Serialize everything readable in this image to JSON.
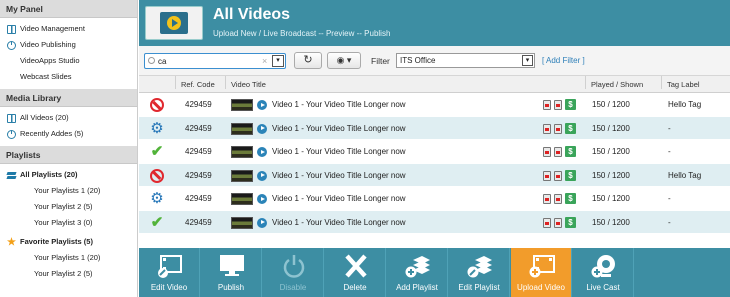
{
  "sidebar": {
    "my_panel": {
      "title": "My Panel",
      "items": [
        {
          "label": "Video Management",
          "icon": "film-icon"
        },
        {
          "label": "Video Publishing",
          "icon": "clock-icon"
        },
        {
          "label": "VideoApps Studio",
          "icon": ""
        },
        {
          "label": "Webcast Slides",
          "icon": ""
        }
      ]
    },
    "media_library": {
      "title": "Media Library",
      "items": [
        {
          "label": "All Videos (20)",
          "icon": "film-icon"
        },
        {
          "label": "Recently Addes (5)",
          "icon": "clock-icon"
        }
      ]
    },
    "playlists": {
      "title": "Playlists",
      "all_label": "All Playlists (20)",
      "all_items": [
        "Your Playlists 1 (20)",
        "Your Playlist 2 (5)",
        "Your Playlist 3 (0)"
      ],
      "fav_label": "Favorite Playlists (5)",
      "fav_items": [
        "Your Playlists 1 (20)",
        "Your Playlist 2 (5)"
      ]
    }
  },
  "header": {
    "title": "All Videos",
    "subtitle": "Upload New / Live Broadcast -- Preview -- Publish"
  },
  "toolbar": {
    "search_value": "ca",
    "search_dropdown_icon": "▾",
    "filter_label": "Filter",
    "filter_value": "ITS Office",
    "add_filter": "[ Add Filter ]"
  },
  "table": {
    "columns": [
      "Ref. Code",
      "Video Title",
      "Played / Shown",
      "Tag Label"
    ],
    "rows": [
      {
        "status": "blocked",
        "ref": "429459",
        "title": "Video 1 - Your Video Title Longer now",
        "played": "150 / 1200",
        "tag": "Hello Tag"
      },
      {
        "status": "processing",
        "ref": "429459",
        "title": "Video 1 - Your Video Title Longer now",
        "played": "150 / 1200",
        "tag": "-"
      },
      {
        "status": "published",
        "ref": "429459",
        "title": "Video 1 - Your Video Title Longer now",
        "played": "150 / 1200",
        "tag": "-"
      },
      {
        "status": "blocked",
        "ref": "429459",
        "title": "Video 1 - Your Video Title Longer now",
        "played": "150 / 1200",
        "tag": "Hello Tag"
      },
      {
        "status": "processing",
        "ref": "429459",
        "title": "Video 1 - Your Video Title Longer now",
        "played": "150 / 1200",
        "tag": "-"
      },
      {
        "status": "published",
        "ref": "429459",
        "title": "Video 1 - Your Video Title Longer now",
        "played": "150 / 1200",
        "tag": "-"
      }
    ],
    "price_badge": "$"
  },
  "bottombar": {
    "buttons": [
      {
        "label": "Edit Video",
        "icon": "edit-video-icon",
        "state": "normal"
      },
      {
        "label": "Publish",
        "icon": "monitor-icon",
        "state": "normal"
      },
      {
        "label": "Disable",
        "icon": "power-icon",
        "state": "disabled"
      },
      {
        "label": "Delete",
        "icon": "x-icon",
        "state": "normal"
      },
      {
        "label": "Add Playlist",
        "icon": "add-playlist-icon",
        "state": "normal"
      },
      {
        "label": "Edit Playlist",
        "icon": "edit-playlist-icon",
        "state": "normal"
      },
      {
        "label": "Upload Video",
        "icon": "upload-video-icon",
        "state": "active"
      },
      {
        "label": "Live Cast",
        "icon": "webcam-icon",
        "state": "normal"
      }
    ]
  },
  "colors": {
    "accent": "#3d8ea3",
    "active": "#f29c2b",
    "row_alt": "#dfeef2"
  }
}
